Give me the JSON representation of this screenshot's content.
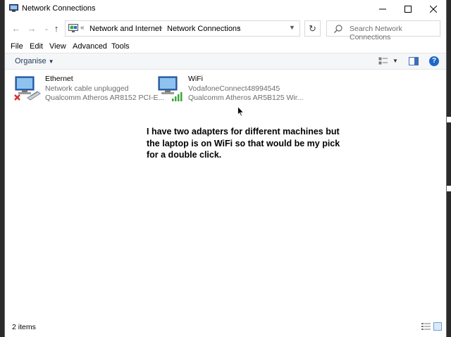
{
  "window": {
    "title": "Network Connections"
  },
  "navigation": {
    "back_icon": "arrow-left-icon",
    "forward_icon": "arrow-right-icon",
    "recent_icon": "chevron-down-icon",
    "up_icon": "arrow-up-icon",
    "breadcrumb": [
      "Network and Internet",
      "Network Connections"
    ],
    "refresh_icon": "refresh-icon",
    "search_placeholder": "Search Network Connections"
  },
  "menu": {
    "items": [
      "File",
      "Edit",
      "View",
      "Advanced",
      "Tools"
    ]
  },
  "commandbar": {
    "organise_label": "Organise"
  },
  "adapters": [
    {
      "name": "Ethernet",
      "status": "Network cable unplugged",
      "device": "Qualcomm Atheros AR8152 PCI-E...",
      "icon": "ethernet-disconnected-icon"
    },
    {
      "name": "WiFi",
      "status": "VodafoneConnect48994545",
      "device": "Qualcomm Atheros AR5B125 Wir...",
      "icon": "wifi-signal-icon"
    }
  ],
  "annotation": "I have two adapters for different machines but\nthe laptop is on WiFi so that would be my pick\nfor  a double click.",
  "statusbar": {
    "item_count": "2 items"
  },
  "colors": {
    "accent": "#1f66c9",
    "organise_text": "#1e395b",
    "error": "#d62b2b",
    "signal": "#3ea83e"
  }
}
